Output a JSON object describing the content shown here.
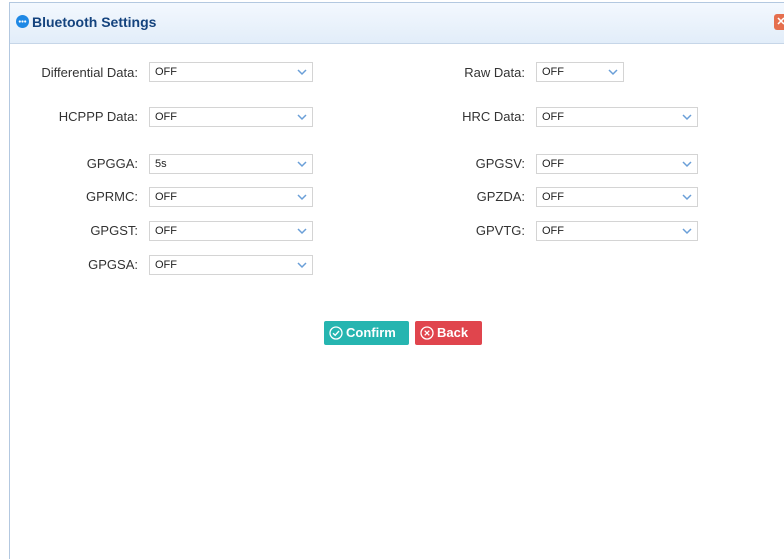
{
  "dialog": {
    "title": "Bluetooth Settings",
    "title_icon": "chat-bubble-icon",
    "close_icon": "close-icon",
    "close_symbol": "✕"
  },
  "fields": {
    "differential": {
      "label": "Differential Data:",
      "value": "OFF"
    },
    "raw": {
      "label": "Raw Data:",
      "value": "OFF"
    },
    "hcppp": {
      "label": "HCPPP Data:",
      "value": "OFF"
    },
    "hrc": {
      "label": "HRC Data:",
      "value": "OFF"
    },
    "gpgga": {
      "label": "GPGGA:",
      "value": "5s"
    },
    "gpgsv": {
      "label": "GPGSV:",
      "value": "OFF"
    },
    "gprmc": {
      "label": "GPRMC:",
      "value": "OFF"
    },
    "gpzda": {
      "label": "GPZDA:",
      "value": "OFF"
    },
    "gpgst": {
      "label": "GPGST:",
      "value": "OFF"
    },
    "gpvtg": {
      "label": "GPVTG:",
      "value": "OFF"
    },
    "gpgsa": {
      "label": "GPGSA:",
      "value": "OFF"
    }
  },
  "actions": {
    "confirm_label": "Confirm",
    "back_label": "Back"
  },
  "colors": {
    "confirm": "#26b5b0",
    "back": "#e0454d",
    "title_text": "#14437e",
    "accent_blue": "#1e88e5"
  }
}
